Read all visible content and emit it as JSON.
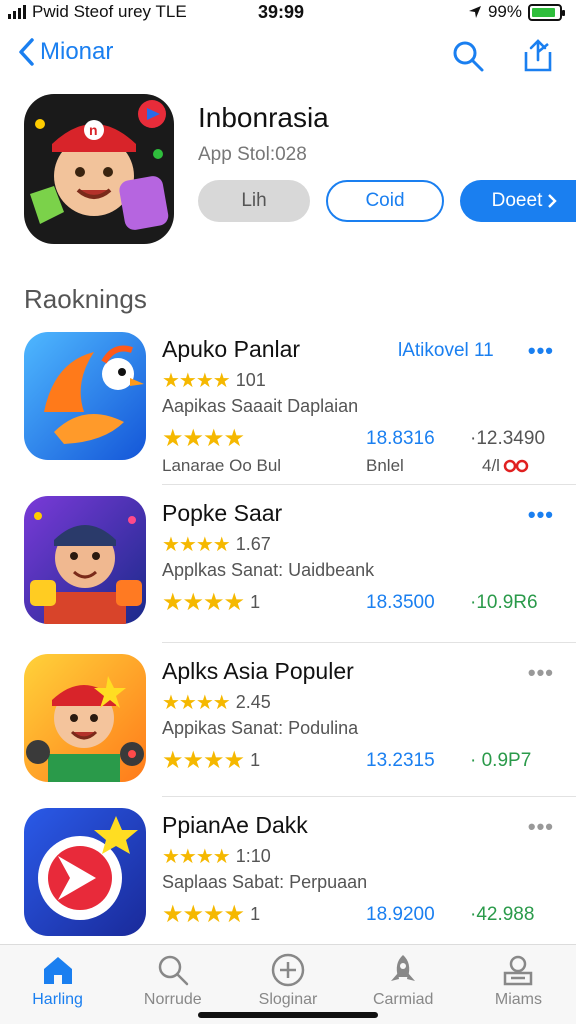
{
  "status": {
    "left": "Pwid Steof urey TLE",
    "time": "39:99",
    "battery": "99%"
  },
  "nav": {
    "back_label": "Mionar"
  },
  "app": {
    "title": "Inbonrasia",
    "subtitle": "App Stol:028",
    "btn_gray": "Lih",
    "btn_outline": "Coid",
    "btn_blue": "Doeet"
  },
  "section": {
    "title": "Raoknings"
  },
  "rankings": [
    {
      "name": "Apuko Panlar",
      "link": "lAtikovel 11",
      "rating": "101",
      "desc": "Aapikas Saaait Daplaian",
      "stat1": "18.8316",
      "stat2": "·12.3490",
      "sub1": "Lanarae Oo Bul",
      "sub2": "Bnlel",
      "sub3": "4/l"
    },
    {
      "name": "Popke Saar",
      "rating": "1.67",
      "desc": "Applkas Sanat: Uaidbeank",
      "rating2": "1",
      "stat1": "18.3500",
      "stat2": "·10.9R6"
    },
    {
      "name": "Aplks Asia Populer",
      "rating": "2.45",
      "desc": "Appikas Sanat: Podulina",
      "rating2": "1",
      "stat1": "13.2315",
      "stat2": "· 0.9P7"
    },
    {
      "name": "PpianAe Dakk",
      "rating": "1:10",
      "desc": "Saplaas Sabat: Perpuaan",
      "rating2": "1",
      "stat1": "18.9200",
      "stat2": "·42.988"
    }
  ],
  "tabs": [
    {
      "label": "Harling",
      "icon": "home-icon"
    },
    {
      "label": "Norrude",
      "icon": "search-icon"
    },
    {
      "label": "Sloginar",
      "icon": "plus-circle-icon"
    },
    {
      "label": "Carmiad",
      "icon": "rocket-icon"
    },
    {
      "label": "Miams",
      "icon": "tray-icon"
    }
  ],
  "colors": {
    "accent": "#1a7ff0",
    "star": "#f5b800",
    "stat_green": "#2a9a4a"
  }
}
